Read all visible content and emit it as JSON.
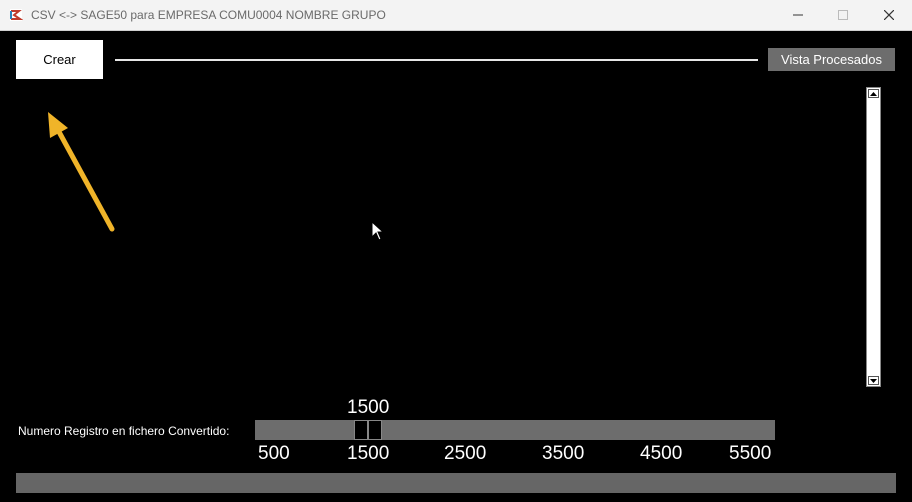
{
  "window": {
    "title": "CSV <-> SAGE50 para EMPRESA COMU0004 NOMBRE GRUPO",
    "icon": "app-logo-icon"
  },
  "toolbar": {
    "crear_label": "Crear",
    "vista_label": "Vista Procesados"
  },
  "slider": {
    "label": "Numero Registro en fichero Convertido:",
    "value": "1500",
    "min": 500,
    "max": 5500,
    "current": 1500,
    "ticks": [
      "500",
      "1500",
      "2500",
      "3500",
      "4500",
      "5500"
    ]
  },
  "colors": {
    "background": "#000000",
    "annotation_arrow": "#f0b429",
    "trough": "#6d6d6d"
  }
}
